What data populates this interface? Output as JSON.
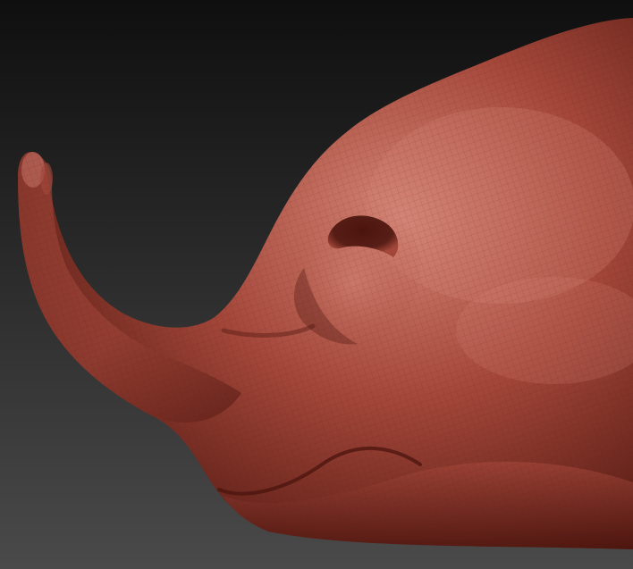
{
  "viewport": {
    "subject": "sculpt-model",
    "background_top": "#0f0f0f",
    "background_bottom": "#4a4a4a",
    "material_base": "#a4473a",
    "material_highlight": "#d48576",
    "material_shadow": "#4a140d",
    "wireframe_color": "#5a1c15"
  }
}
